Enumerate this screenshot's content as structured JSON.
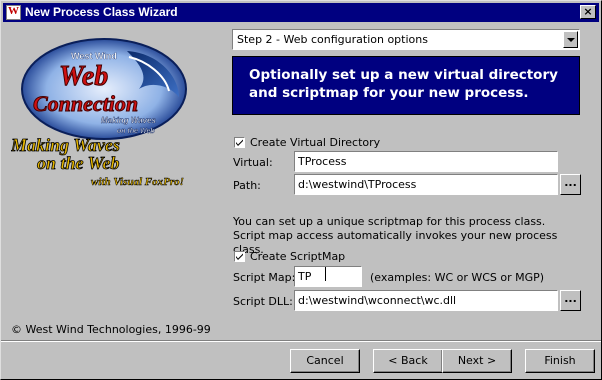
{
  "window": {
    "title": "New Process Class Wizard",
    "close_glyph": "×"
  },
  "logo": {
    "line1": "West Wind",
    "line2": "Web",
    "line3": "Connection",
    "tagline1": "Making Waves",
    "tagline2": "on the Web"
  },
  "slogan": {
    "line1": "Making Waves",
    "line2": "on the Web",
    "line3": "with Visual FoxPro!"
  },
  "copyright": "© West Wind Technologies, 1996-99",
  "step_select": {
    "value": "Step 2 - Web configuration options"
  },
  "banner": {
    "text": "Optionally set up a new virtual directory and scriptmap for your new process."
  },
  "virtual_dir": {
    "checkbox_label": "Create Virtual Directory",
    "checked": true,
    "virtual_label": "Virtual:",
    "virtual_value": "TProcess",
    "path_label": "Path:",
    "path_value": "d:\\westwind\\TProcess",
    "browse_label": "..."
  },
  "scriptmap_info": "You can set up a unique scriptmap for this process class. Script map access automatically invokes your new process class.",
  "scriptmap": {
    "checkbox_label": "Create ScriptMap",
    "checked": true,
    "map_label": "Script Map:",
    "map_value": "TP",
    "examples": "(examples: WC or WCS or MGP)",
    "dll_label": "Script DLL:",
    "dll_value": "d:\\westwind\\wconnect\\wc.dll",
    "browse_label": "..."
  },
  "buttons": {
    "cancel": "Cancel",
    "back": "< Back",
    "next": "Next >",
    "finish": "Finish"
  },
  "colors": {
    "face": "#c0c0c0",
    "titlebar": "#000080",
    "banner": "#000080",
    "slogan": "#e8b800"
  }
}
